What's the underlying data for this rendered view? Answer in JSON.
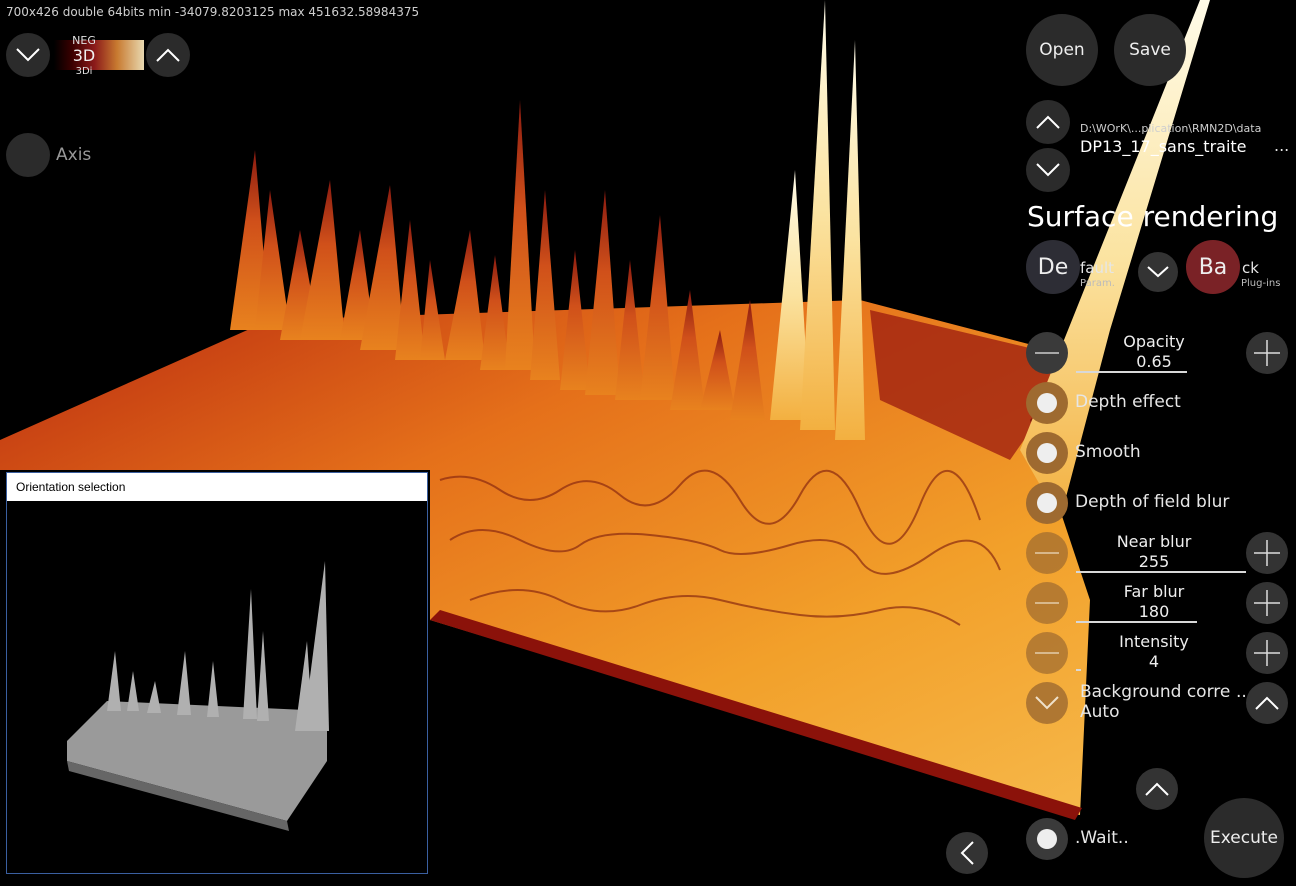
{
  "header": {
    "info": "700x426 double 64bits min -34079.8203125 max 451632.58984375"
  },
  "colormap": {
    "neg": "NEG",
    "mode": "3D",
    "sub": "3Di"
  },
  "axis": {
    "label": "Axis"
  },
  "inset": {
    "title": "Orientation selection"
  },
  "toolbar": {
    "open": "Open",
    "save": "Save"
  },
  "file": {
    "path": "D:\\WOrK\\...plication\\RMN2D\\data",
    "name": "DP13_17_sans_traite",
    "more": "..."
  },
  "panel": {
    "title": "Surface rendering",
    "default_big": "De",
    "default_rest": "fault",
    "default_sub": "Param.",
    "back_big": "Ba",
    "back_rest": "ck",
    "back_sub": "Plug-ins",
    "opacity_label": "Opacity",
    "opacity_value": "0.65",
    "depth_effect": "Depth effect",
    "smooth": "Smooth",
    "dof_blur": "Depth of field blur",
    "near_blur_label": "Near blur",
    "near_blur_value": "255",
    "far_blur_label": "Far blur",
    "far_blur_value": "180",
    "intensity_label": "Intensity",
    "intensity_value": "4",
    "bg_corr_label": "Background corre",
    "bg_corr_more": "...",
    "bg_corr_value": "Auto",
    "wait": ".Wait..",
    "execute": "Execute"
  },
  "colors": {
    "accent_red": "#7a2226",
    "radio_bronze": "#9e6a30",
    "surface_hot": "#f6c25a",
    "surface_cold": "#a51d0e"
  }
}
